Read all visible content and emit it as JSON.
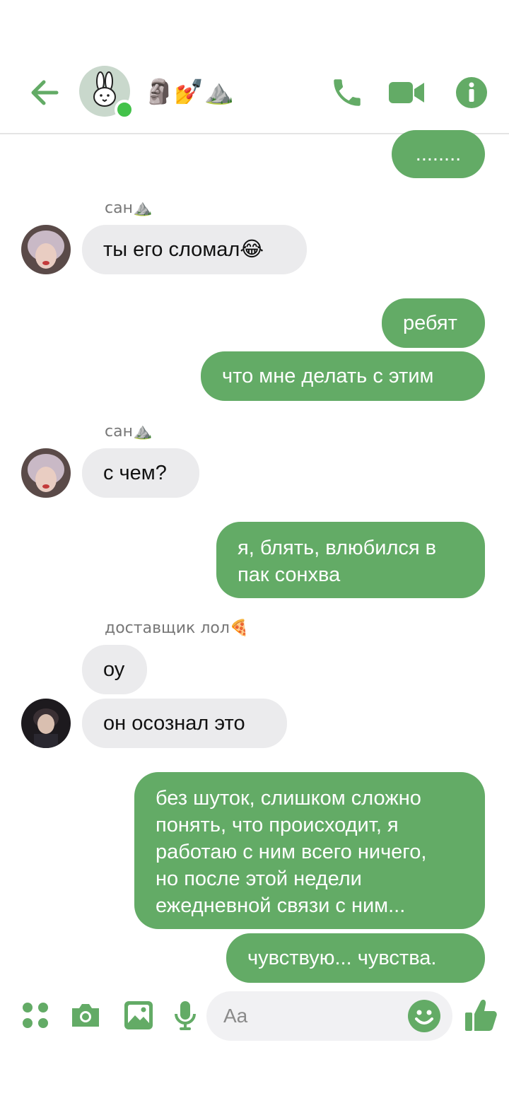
{
  "header": {
    "title": "🗿💅⛰️",
    "icons": [
      "back-arrow-icon",
      "phone-icon",
      "video-icon",
      "info-icon"
    ]
  },
  "messages": {
    "m1": "........",
    "s1": "сан⛰️",
    "m2": "ты его сломал😂",
    "m3": "ребят",
    "m4": "что мне делать с этим",
    "s2": "сан⛰️",
    "m5": "с чем?",
    "m6": "я, блять, влюбился в\nпак сонхва",
    "s3": "доставщик лол🍕",
    "m7": "оу",
    "m8": "он осознал это",
    "m9": "без шуток, слишком сложно\nпонять, что происходит, я\nработаю с ним всего ничего,\nно после этой недели\nежедневной связи с ним...",
    "m10": "чувствую... чувства."
  },
  "composer": {
    "placeholder": "Aa",
    "icons": [
      "apps-icon",
      "camera-icon",
      "gallery-icon",
      "microphone-icon",
      "emoji-icon",
      "thumbs-up-icon"
    ]
  },
  "colors": {
    "accent": "#63ab66",
    "incoming_bubble": "#ebebed",
    "online": "#43c24a"
  }
}
